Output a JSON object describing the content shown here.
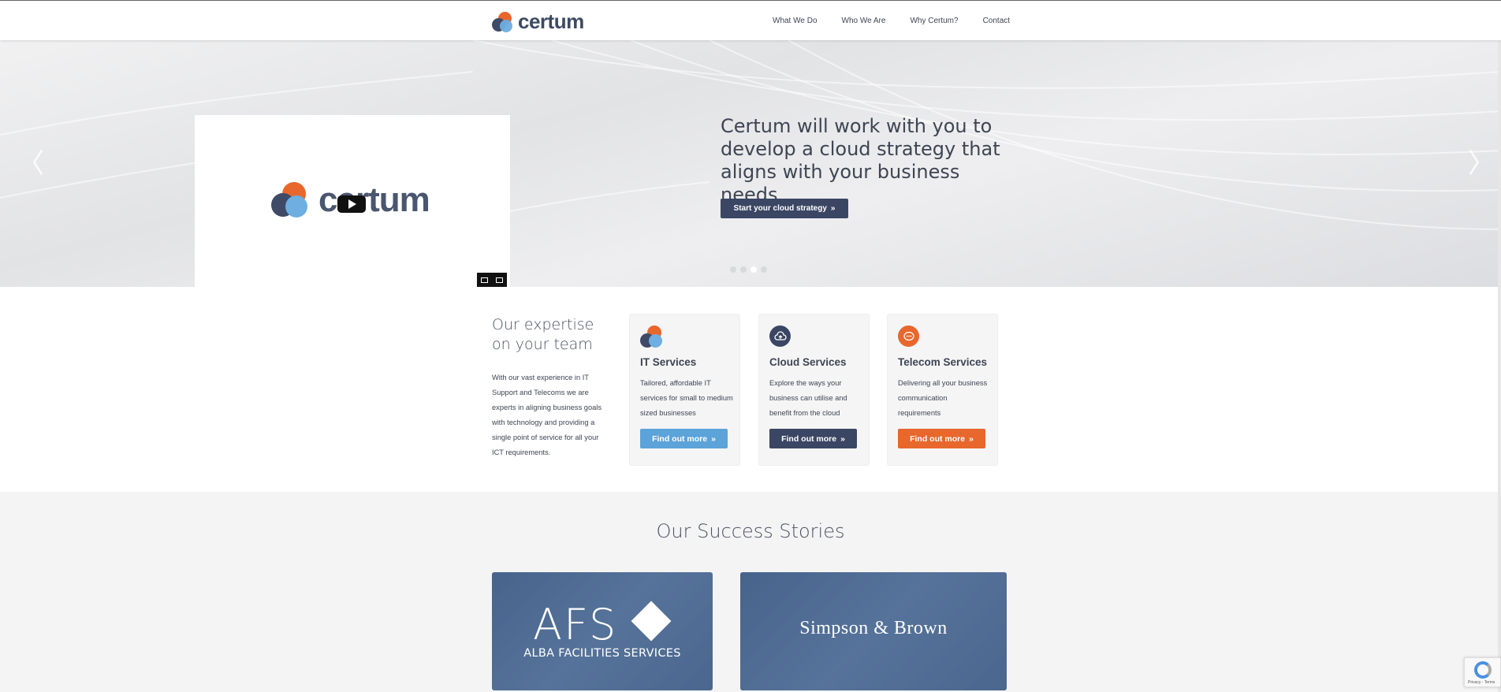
{
  "header": {
    "logo_text": "certum",
    "nav": [
      "What We Do",
      "Who We Are",
      "Why Certum?",
      "Contact"
    ]
  },
  "hero": {
    "video_logo_text": "certum",
    "headline": "Certum will work with you to develop a cloud strategy that aligns with your business needs",
    "cta_label": "Start your cloud strategy",
    "prev_arrow": "〈",
    "next_arrow": "〉",
    "slide_count": 4,
    "active_slide": 3
  },
  "expertise": {
    "title": "Our expertise on your team",
    "body": "With our vast experience in IT Support and Telecoms we are experts in aligning business goals with technology and providing a single point of service for all your ICT requirements.",
    "cards": [
      {
        "title": "IT Services",
        "text": "Tailored, affordable IT services for small to medium sized businesses",
        "button": "Find out more",
        "color": "#5ba3d9",
        "icon": "certum-logo-icon"
      },
      {
        "title": "Cloud Services",
        "text": "Explore the ways your business can utilise and benefit from the cloud",
        "button": "Find out more",
        "color": "#3a4663",
        "icon": "cloud-upload-icon"
      },
      {
        "title": "Telecom Services",
        "text": "Delivering all your business communication requirements",
        "button": "Find out more",
        "color": "#e8672c",
        "icon": "chat-bubble-icon"
      }
    ]
  },
  "success": {
    "title": "Our Success Stories",
    "stories": [
      {
        "logo_main": "AFS",
        "logo_sub": "ALBA FACILITIES SERVICES"
      },
      {
        "logo_main": "Simpson & Brown"
      }
    ]
  },
  "recaptcha": {
    "text": "Privacy - Terms"
  },
  "colors": {
    "navy": "#3a4663",
    "orange": "#e8672c",
    "blue": "#5ba3d9"
  }
}
